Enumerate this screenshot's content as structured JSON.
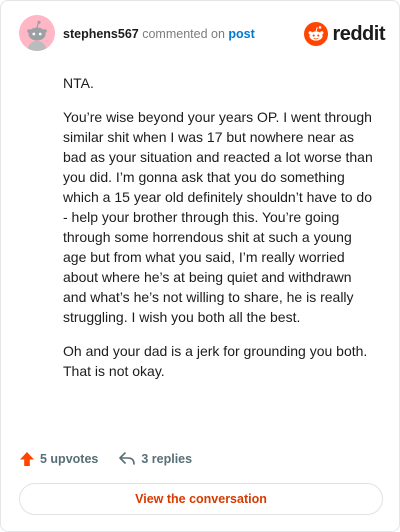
{
  "header": {
    "username": "stephens567",
    "action_text": "commented on",
    "post_link": "post",
    "brand_name": "reddit"
  },
  "comment": {
    "paragraphs": [
      "NTA.",
      "You’re wise beyond your years OP. I went through similar shit when I was 17 but nowhere near as bad as your situation and reacted a lot worse than you did. I’m gonna ask that you do something which a 15 year old definitely shouldn’t have to do - help your brother through this. You’re going through some horrendous shit at such a young age but from what you said, I’m really worried about where he’s at being quiet and withdrawn and what’s he’s not willing to share, he is really struggling. I wish you both all the best.",
      "Oh and your dad is a jerk for grounding you both. That is not okay."
    ]
  },
  "stats": {
    "upvotes_label": "5 upvotes",
    "replies_label": "3 replies"
  },
  "view_button_label": "View the conversation",
  "colors": {
    "accent": "#d93a00",
    "upvote": "#ff4500",
    "link": "#0079d3",
    "avatar_bg": "#ffb7c6"
  },
  "icons": {
    "avatar": "snoo-avatar-icon",
    "brand": "reddit-logo-icon",
    "upvote": "upvote-arrow-icon",
    "reply": "reply-arrow-icon"
  }
}
